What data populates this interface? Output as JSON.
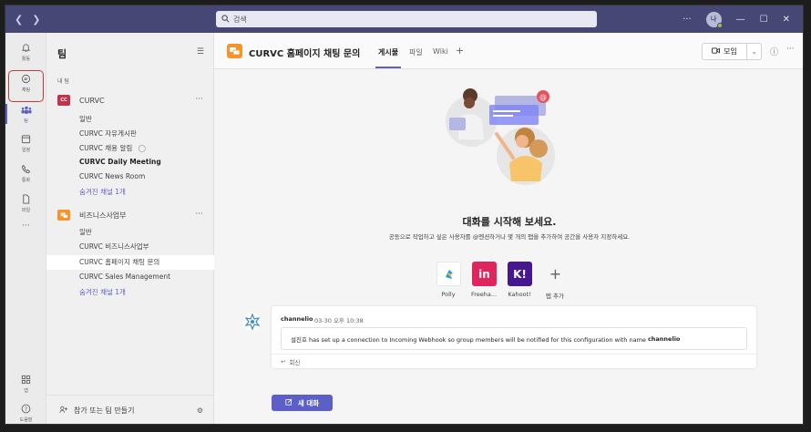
{
  "titlebar": {
    "search_placeholder": "검색",
    "avatar_initial": "나",
    "more": "···"
  },
  "rail": {
    "items": [
      {
        "label": "활동",
        "icon": "bell-icon"
      },
      {
        "label": "채팅",
        "icon": "chat-icon"
      },
      {
        "label": "팀",
        "icon": "teams-icon"
      },
      {
        "label": "일정",
        "icon": "calendar-icon"
      },
      {
        "label": "통화",
        "icon": "phone-icon"
      },
      {
        "label": "파일",
        "icon": "file-icon"
      }
    ],
    "more": "···",
    "apps_label": "앱",
    "help_label": "도움말"
  },
  "teams_panel": {
    "title": "팀",
    "section_label": "내 팀",
    "teams": [
      {
        "name": "CURVC",
        "logo_text": "CC",
        "logo_color": "#c4314b",
        "more": "···",
        "channels": [
          {
            "name": "일반"
          },
          {
            "name": "CURVC 자유게시판"
          },
          {
            "name": "CURVC 채용 알림"
          },
          {
            "name": "CURVC Daily Meeting"
          },
          {
            "name": "CURVC News Room"
          },
          {
            "name": "숨겨진 채널 1개"
          }
        ]
      },
      {
        "name": "비즈니스사업부",
        "logo_text": "",
        "logo_color": "#f7932a",
        "more": "···",
        "channels": [
          {
            "name": "일반"
          },
          {
            "name": "CURVC 비즈니스사업부"
          },
          {
            "name": "CURVC 홈페이지 채팅 문의"
          },
          {
            "name": "CURVC Sales Management"
          },
          {
            "name": "숨겨진 채널 1개"
          }
        ]
      }
    ],
    "footer_label": "참가 또는 팀 만들기"
  },
  "channel": {
    "title": "CURVC 홈페이지 채팅 문의",
    "tabs": [
      "게시물",
      "파일",
      "Wiki"
    ],
    "add_tab": "+",
    "meet_label": "모임",
    "info": "ⓘ",
    "more": "···"
  },
  "empty_state": {
    "title": "대화를 시작해 보세요.",
    "subtitle": "공동으로 작업하고 싶은 사용자를 @멘션하거나 몇 개의 탭을 추가하여 공간을 사용자 지정하세요."
  },
  "apps": [
    {
      "label": "Polly",
      "color": "#ffffff",
      "glyph": ""
    },
    {
      "label": "Freeha...",
      "color": "#e0245e",
      "glyph": "in"
    },
    {
      "label": "Kahoot!",
      "color": "#46178f",
      "glyph": "K!"
    },
    {
      "label": "탭 추가",
      "color": "#ffffff",
      "glyph": "+"
    }
  ],
  "post": {
    "author": "channelio",
    "time": "03-30 오후 10:38",
    "message_prefix": "설진호 has set up a connection to Incoming Webhook so group members will be notified for this configuration with name",
    "message_name": "channelio",
    "reply_label": "회신"
  },
  "new_conversation_label": "새 대화"
}
